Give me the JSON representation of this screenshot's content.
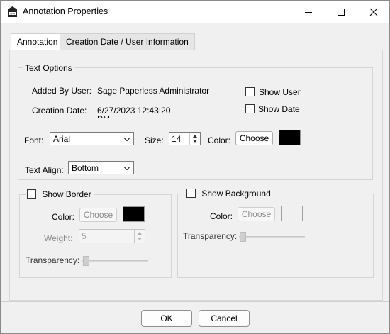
{
  "window": {
    "title": "Annotation Properties",
    "close_glyph": "✕"
  },
  "tabs": [
    {
      "label": "Annotation",
      "selected": true
    },
    {
      "label": "Creation Date / User Information",
      "selected": false
    }
  ],
  "text_options": {
    "legend": "Text Options",
    "added_by_label": "Added By User:",
    "added_by_value": "Sage Paperless Administrator",
    "creation_date_label": "Creation Date:",
    "creation_date_value": "6/27/2023 12:43:20",
    "creation_date_overflow": "PM",
    "show_user_label": "Show User",
    "show_user_checked": false,
    "show_date_label": "Show Date",
    "show_date_checked": false,
    "font_label": "Font:",
    "font_value": "Arial",
    "size_label": "Size:",
    "size_value": "14",
    "color_label": "Color:",
    "color_button": "Choose",
    "color_value": "#000000",
    "text_align_label": "Text Align:",
    "text_align_value": "Bottom"
  },
  "border": {
    "checkbox_label": "Show Border",
    "checked": false,
    "color_label": "Color:",
    "color_button": "Choose",
    "color_value": "#000000",
    "weight_label": "Weight:",
    "weight_value": "5",
    "transparency_label": "Transparency:",
    "transparency_level": 0
  },
  "background": {
    "checkbox_label": "Show Background",
    "checked": false,
    "color_label": "Color:",
    "color_button": "Choose",
    "color_value": "#f0f0f0",
    "transparency_label": "Transparency:",
    "transparency_level": 0
  },
  "footer": {
    "ok_label": "OK",
    "cancel_label": "Cancel"
  },
  "icons": [
    "app-logo-icon",
    "minimize-icon",
    "maximize-icon",
    "close-icon",
    "chevron-down-icon",
    "spin-up-icon",
    "spin-down-icon"
  ]
}
